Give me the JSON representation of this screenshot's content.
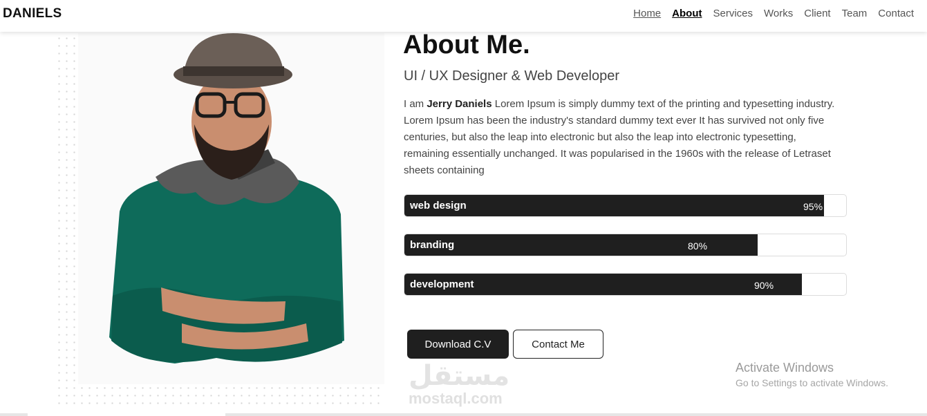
{
  "brand": "DANIELS",
  "nav": [
    {
      "label": "Home",
      "state": "underlined"
    },
    {
      "label": "About",
      "state": "active"
    },
    {
      "label": "Services",
      "state": ""
    },
    {
      "label": "Works",
      "state": ""
    },
    {
      "label": "Client",
      "state": ""
    },
    {
      "label": "Team",
      "state": ""
    },
    {
      "label": "Contact",
      "state": ""
    }
  ],
  "about": {
    "title": "About Me.",
    "subtitle": "UI / UX Designer & Web Developer",
    "bio_prefix": "I am ",
    "bio_name": "Jerry Daniels",
    "bio_text": " Lorem Ipsum is simply dummy text of the printing and typesetting industry. Lorem Ipsum has been the industry's standard dummy text ever It has survived not only five centuries, but also the leap into electronic but also the leap into electronic typesetting, remaining essentially unchanged. It was popularised in the 1960s with the release of Letraset sheets containing"
  },
  "skills": [
    {
      "name": "web design",
      "percent": 95,
      "label": "95%"
    },
    {
      "name": "branding",
      "percent": 80,
      "label": "80%"
    },
    {
      "name": "development",
      "percent": 90,
      "label": "90%"
    }
  ],
  "buttons": {
    "download": "Download C.V",
    "contact": "Contact Me"
  },
  "watermark": {
    "arabic": "مستقل",
    "latin": "mostaql.com"
  },
  "activation": {
    "title": "Activate Windows",
    "hint": "Go to Settings to activate Windows."
  },
  "photo": {
    "icon": "portrait-man-hat-icon",
    "colors": {
      "sweater": "#0e6b5a",
      "hat": "#6b5f57",
      "skin": "#c98e6f",
      "beard": "#2b1f1a",
      "scarf": "#5a5a5a"
    }
  }
}
